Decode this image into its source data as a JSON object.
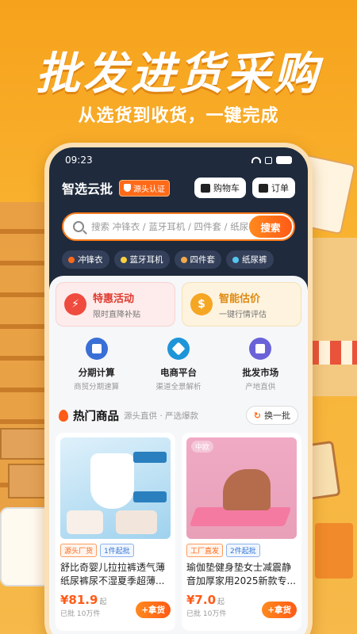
{
  "banner": {
    "headline": "批发进货采购",
    "subline": "从选货到收货，一键完成"
  },
  "status": {
    "time": "09:23"
  },
  "app": {
    "title": "智选云批",
    "badge": "源头认证",
    "cart_label": "购物车",
    "orders_label": "订单"
  },
  "search": {
    "placeholder": "搜索 冲锋衣 / 蓝牙耳机 / 四件套 / 纸尿裤",
    "button": "搜索"
  },
  "chips": [
    {
      "label": "冲锋衣",
      "icon": "fire-icon",
      "color": "#ff6a18"
    },
    {
      "label": "蓝牙耳机",
      "icon": "lightning-icon",
      "color": "#ffd23d"
    },
    {
      "label": "四件套",
      "icon": "box-icon",
      "color": "#f2a94a"
    },
    {
      "label": "纸尿裤",
      "icon": "diamond-icon",
      "color": "#55c6f2"
    }
  ],
  "feature_cards": [
    {
      "title": "特惠活动",
      "subtitle": "限时直降补贴",
      "icon": "lightning-icon",
      "color": "#ef4b3f",
      "title_color": "#e0392e"
    },
    {
      "title": "智能估价",
      "subtitle": "一键行情评估",
      "icon": "dollar-coin-icon",
      "color": "#f5a623",
      "title_color": "#e08a10"
    }
  ],
  "services": [
    {
      "title": "分期计算",
      "subtitle": "商贸分期速算",
      "icon": "calculator-icon",
      "color": "#3a6fd6"
    },
    {
      "title": "电商平台",
      "subtitle": "渠道全景解析",
      "icon": "cube-icon",
      "color": "#1e95d8"
    },
    {
      "title": "批发市场",
      "subtitle": "产地直供",
      "icon": "store-icon",
      "color": "#6a63d8"
    }
  ],
  "hot": {
    "title": "热门商品",
    "subtitle": "源头直供 · 严选爆款",
    "refresh": "换一批"
  },
  "products": [
    {
      "tags": [
        "源头厂货",
        "1件起批"
      ],
      "title": "舒比奇婴儿拉拉裤透气薄纸尿裤尿不湿夏季超薄...",
      "price": "¥81.9",
      "price_unit": "起",
      "sold": "已批 10万件",
      "button": "+拿货"
    },
    {
      "brand": "中欧",
      "tags": [
        "工厂直发",
        "2件起批"
      ],
      "title": "瑜伽垫健身垫女士减震静音加厚家用2025新款专...",
      "price": "¥7.0",
      "price_unit": "起",
      "sold": "已批 10万件",
      "button": "+拿货"
    }
  ]
}
